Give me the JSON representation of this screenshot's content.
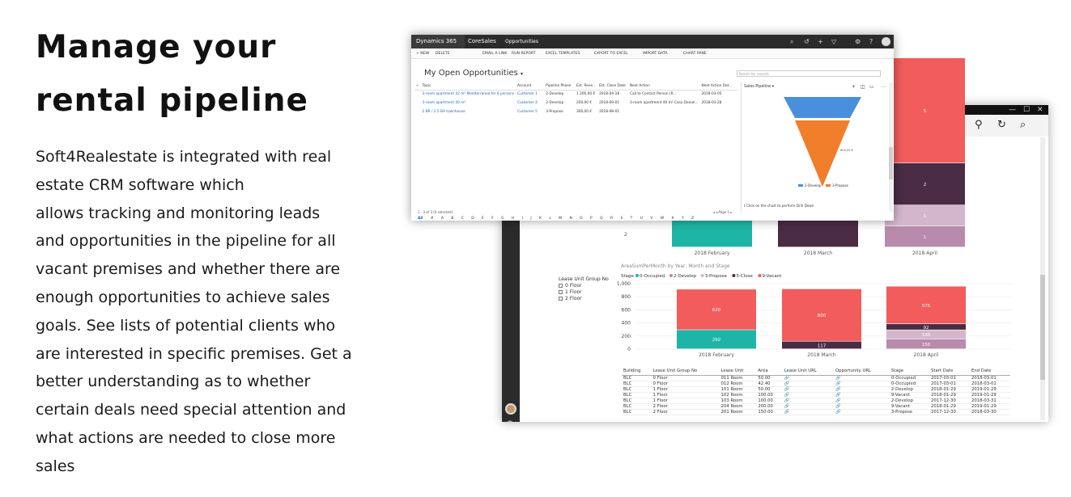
{
  "hero": {
    "title_line1": "Manage your",
    "title_line2": "rental pipeline",
    "body_lines": [
      "Soft4Realestate is integrated with real",
      "estate CRM software which",
      "allows tracking and monitoring leads",
      "and opportunities in the pipeline for all",
      "vacant premises and whether there are",
      "enough opportunities to achieve sales",
      "goals. See lists of potential clients who",
      "are interested in specific premises. Get a",
      "better understanding as to whether",
      "certain deals need special attention and",
      "what actions are needed to close more",
      "sales"
    ]
  },
  "crm": {
    "brand": "Dynamics 365",
    "app": "CoreSales",
    "area": "Opportunities",
    "commands": [
      "+ NEW",
      "DELETE",
      "EMAIL A LINK",
      "RUN REPORT",
      "EXCEL TEMPLATES",
      "EXPORT TO EXCEL",
      "IMPORT DATA",
      "CHART PANE"
    ],
    "view_title": "My Open Opportunities",
    "search_placeholder": "Search for records",
    "columns": [
      "Topic",
      "Account",
      "Pipeline Phase",
      "Est. Reve...",
      "Est. Close Date",
      "Next Action",
      "Next Action Dat..."
    ],
    "rows": [
      [
        "3-room apartment 42 m² Mediterranea for 6 persons",
        "Customer 1",
        "2-Develop",
        "1 200,00 €",
        "2018-04-18",
        "Call to Contact Person (R...",
        "2018-03-05"
      ],
      [
        "3-room apartment 40 m²",
        "Customer 4",
        "2-Develop",
        "200,00 €",
        "2018-09-01",
        "3-room apartment 40 m² Casa Daniel...",
        "2018-03-28"
      ],
      [
        "2 BR / 2.5 BA townhouse",
        "Customer 5",
        "3-Propose",
        "300,00 €",
        "2018-08-01",
        "",
        ""
      ]
    ],
    "footer_count": "1 - 3 of 3 (0 selected)",
    "pager": "◂ ◂ Page 1 ▸",
    "alphabet": [
      "All",
      "#",
      "A",
      "B",
      "C",
      "D",
      "E",
      "F",
      "G",
      "H",
      "I",
      "J",
      "K",
      "L",
      "M",
      "N",
      "O",
      "P",
      "Q",
      "R",
      "S",
      "T",
      "U",
      "V",
      "W",
      "X",
      "Y",
      "Z"
    ],
    "chart_pane": {
      "title": "Sales Pipeline",
      "value_label": "600,00 €",
      "legend": [
        "2-Develop",
        "3-Propose"
      ],
      "footnote": "Click on the chart to perform Drill Down"
    }
  },
  "pbi": {
    "slicer_title": "Lease Unit Group No",
    "slicer_items": [
      "0 Floor",
      "1 Floor",
      "2 Floor"
    ],
    "table_columns": [
      "Building",
      "Lease Unit Group No",
      "Lease Unit",
      "Area",
      "Lease Unit URL",
      "Opportunity URL",
      "Stage",
      "Start Date",
      "End Date"
    ],
    "table_rows": [
      [
        "BLC",
        "0 Floor",
        "011 Room",
        "50.00",
        "🔗",
        "🔗",
        "0-Occupied",
        "2017-03-01",
        "2018-03-01"
      ],
      [
        "BLC",
        "0 Floor",
        "012 Room",
        "42.40",
        "🔗",
        "🔗",
        "0-Occupied",
        "2017-03-01",
        "2018-03-01"
      ],
      [
        "BLC",
        "1 Floor",
        "101 Room",
        "50.00",
        "🔗",
        "🔗",
        "2-Develop",
        "2018-01-29",
        "2019-01-29"
      ],
      [
        "BLC",
        "1 Floor",
        "102 Room",
        "100.00",
        "🔗",
        "🔗",
        "9-Vacant",
        "2018-01-29",
        "2019-01-29"
      ],
      [
        "BLC",
        "1 Floor",
        "103 Room",
        "100.00",
        "🔗",
        "🔗",
        "2-Develop",
        "2017-12-30",
        "2018-03-31"
      ],
      [
        "BLC",
        "2 Floor",
        "204 Room",
        "200.00",
        "🔗",
        "🔗",
        "9-Vacant",
        "2018-01-29",
        "2019-01-29"
      ],
      [
        "BLC",
        "2 Floor",
        "201 Room",
        "150.00",
        "🔗",
        "🔗",
        "3-Propose",
        "2017-12-30",
        "2018-03-30"
      ]
    ]
  },
  "chart_data": [
    {
      "type": "bar",
      "title": "",
      "stacked": true,
      "categories": [
        "2018 February",
        "2018 March",
        "2018 April"
      ],
      "ylim": [
        0,
        6
      ],
      "yticks": [
        2
      ],
      "series": [
        {
          "name": "0-Occupied",
          "color": "#1fb5a6",
          "values": [
            3,
            0,
            0
          ]
        },
        {
          "name": "2-Develop",
          "color": "#b88aac",
          "values": [
            0,
            0,
            1
          ]
        },
        {
          "name": "3-Propose",
          "color": "#d3b6cc",
          "values": [
            0,
            0,
            1
          ]
        },
        {
          "name": "5-Close",
          "color": "#4a2c44",
          "values": [
            0,
            3,
            2
          ]
        },
        {
          "name": "9-Vacant",
          "color": "#f25c5c",
          "values": [
            2,
            2,
            5
          ]
        }
      ],
      "data_labels": [
        [
          "3"
        ],
        [
          "3"
        ],
        [
          "5",
          "2",
          "1",
          "1"
        ]
      ]
    },
    {
      "type": "bar",
      "title": "AreaSumPerMonth by Year, Month and Stage",
      "stacked": true,
      "legend_title": "Stage",
      "categories": [
        "2018 February",
        "2018 March",
        "2018 April"
      ],
      "ylim": [
        0,
        1000
      ],
      "yticks": [
        0,
        200,
        400,
        600,
        800,
        1000
      ],
      "ytick_labels": [
        "0",
        "200",
        "400",
        "600",
        "800",
        "1,000"
      ],
      "series": [
        {
          "name": "0-Occupied",
          "color": "#1fb5a6",
          "values": [
            292,
            0,
            0
          ]
        },
        {
          "name": "2-Develop",
          "color": "#b88aac",
          "values": [
            0,
            0,
            150
          ]
        },
        {
          "name": "3-Propose",
          "color": "#d3b6cc",
          "values": [
            0,
            0,
            140
          ]
        },
        {
          "name": "5-Close",
          "color": "#4a2c44",
          "values": [
            0,
            117,
            92
          ]
        },
        {
          "name": "9-Vacant",
          "color": "#f25c5c",
          "values": [
            620,
            800,
            575
          ]
        }
      ],
      "point_labels": [
        {
          "cat": 0,
          "series": "0-Occupied",
          "label": "292"
        },
        {
          "cat": 0,
          "series": "9-Vacant",
          "label": "620"
        },
        {
          "cat": 1,
          "series": "5-Close",
          "label": "117"
        },
        {
          "cat": 1,
          "series": "9-Vacant",
          "label": "800"
        },
        {
          "cat": 2,
          "series": "2-Develop",
          "label": "150"
        },
        {
          "cat": 2,
          "series": "3-Propose",
          "label": "140"
        },
        {
          "cat": 2,
          "series": "5-Close",
          "label": "92"
        },
        {
          "cat": 2,
          "series": "9-Vacant",
          "label": "575"
        }
      ]
    },
    {
      "type": "funnel",
      "title": "Sales Pipeline",
      "categories": [
        "2-Develop",
        "3-Propose"
      ],
      "values": [
        200,
        600
      ],
      "colors": [
        "#4a8fdc",
        "#f07e2a"
      ]
    }
  ]
}
